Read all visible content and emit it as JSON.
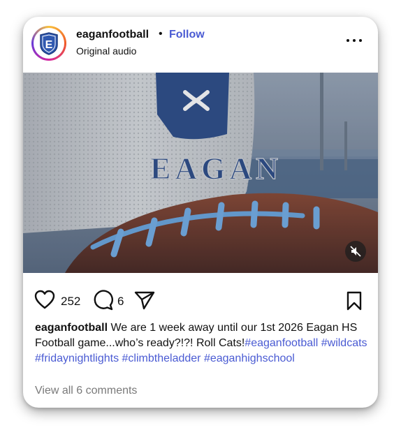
{
  "post": {
    "username": "eaganfootball",
    "separator": "•",
    "follow_label": "Follow",
    "subtitle": "Original audio",
    "avatar_letter": "E",
    "more_icon": "more-dots-icon"
  },
  "media": {
    "jersey_text": "EAGAN",
    "mute_icon": "muted-speaker-icon"
  },
  "actions": {
    "likes": "252",
    "comments": "6",
    "icons": [
      "heart-icon",
      "comment-icon",
      "share-icon",
      "bookmark-icon"
    ]
  },
  "caption": {
    "username": "eaganfootball",
    "text": " We are 1 week away until our 1st 2026 Eagan HS Football game...who’s ready?!?! Roll Cats!",
    "hashtags": [
      "#eaganfootball",
      "#wildcats",
      "#fridaynightlights",
      "#climbtheladder",
      "#eaganhighschool"
    ]
  },
  "view_comments": "View all 6 comments",
  "colors": {
    "link": "#4a5bd3",
    "muted": "#7a7a7a",
    "jersey_blue": "#2f4f8a"
  }
}
